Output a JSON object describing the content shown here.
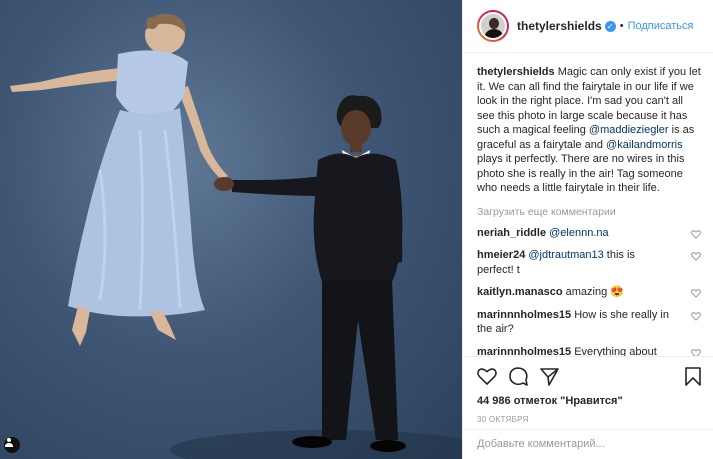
{
  "post": {
    "username": "thetylershields",
    "follow_label": "Подписаться",
    "caption_user": "thetylershields",
    "caption_part1": " Magic can only exist if you let it. We can all find the fairytale in our life if we look in the right place. I'm sad you can't all see this photo in large scale because it has such a magical feeling ",
    "caption_mention1": "@maddieziegler",
    "caption_part2": " is as graceful as a fairytale and ",
    "caption_mention2": "@kailandmorris",
    "caption_part3": " plays it perfectly. There are no wires in this photo she is really in the air! Tag someone who needs a little fairytale in their life.",
    "load_more": "Загрузить еще комментарии",
    "likes": "44 986 отметок \"Нравится\"",
    "date": "30 октября",
    "add_comment_placeholder": "Добавьте комментарий..."
  },
  "comments": [
    {
      "user": "neriah_riddle",
      "text": "",
      "mention": "@elennn.na"
    },
    {
      "user": "hmeier24",
      "text": " this is perfect! t",
      "mention": "@jdtrautman13"
    },
    {
      "user": "kaitlyn.manasco",
      "text": "amazing 😍",
      "mention": ""
    },
    {
      "user": "marinnnholmes15",
      "text": "How is she really in the air?",
      "mention": ""
    },
    {
      "user": "marinnnholmes15",
      "text": "Everything about",
      "mention": ""
    }
  ],
  "icons": {
    "like": "heart-icon",
    "comment": "comment-icon",
    "share": "share-icon",
    "save": "bookmark-icon",
    "tag": "user-tag-icon",
    "verified": "verified-badge-icon"
  },
  "colors": {
    "link": "#3897f0",
    "mention": "#003569",
    "muted": "#999999",
    "backdrop": "#3f5775"
  }
}
